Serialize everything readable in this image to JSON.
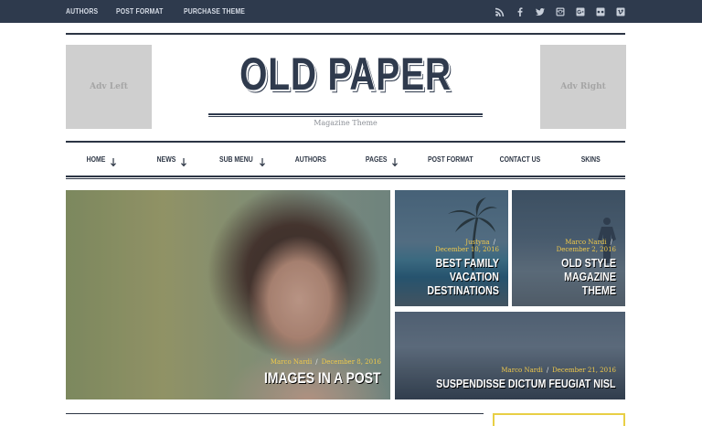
{
  "topbar": {
    "links": [
      "AUTHORS",
      "POST FORMAT",
      "PURCHASE THEME"
    ],
    "social_icons": [
      "rss-icon",
      "facebook-icon",
      "twitter-icon",
      "instagram-icon",
      "google-plus-icon",
      "flickr-icon",
      "vimeo-icon"
    ]
  },
  "header": {
    "adv_left": "Adv Left",
    "adv_right": "Adv Right",
    "logo": "OLD PAPER",
    "tagline": "Magazine Theme"
  },
  "nav": {
    "items": [
      {
        "label": "HOME",
        "has_dropdown": true
      },
      {
        "label": "NEWS",
        "has_dropdown": true
      },
      {
        "label": "SUB MENU",
        "has_dropdown": true
      },
      {
        "label": "AUTHORS",
        "has_dropdown": false
      },
      {
        "label": "PAGES",
        "has_dropdown": true
      },
      {
        "label": "POST FORMAT",
        "has_dropdown": false
      },
      {
        "label": "CONTACT US",
        "has_dropdown": false
      },
      {
        "label": "SKINS",
        "has_dropdown": false
      }
    ]
  },
  "featured": {
    "big": {
      "author": "Marco Nardi",
      "date": "December 8, 2016",
      "title": "IMAGES IN A POST"
    },
    "tile1": {
      "author": "Justyna",
      "date": "December 10, 2016",
      "title_line1": "BEST FAMILY VACATION",
      "title_line2": "DESTINATIONS"
    },
    "tile2": {
      "author": "Marco Nardi",
      "date": "December 2, 2016",
      "title_line1": "OLD STYLE MAGAZINE",
      "title_line2": "THEME"
    },
    "tile3": {
      "author": "Marco Nardi",
      "date": "December 21, 2016",
      "title": "SUSPENDISSE DICTUM FEUGIAT NISL"
    }
  },
  "colors": {
    "topbar_bg": "#2e3a4d",
    "accent_yellow": "#f0c94b",
    "text_dark": "#2c3544"
  }
}
